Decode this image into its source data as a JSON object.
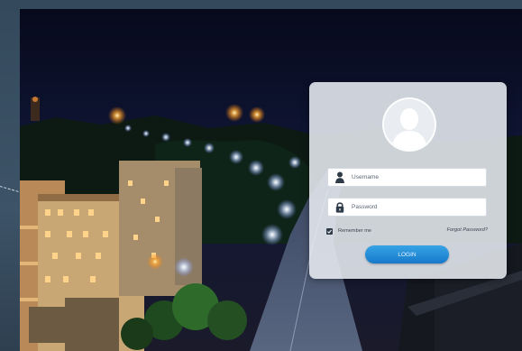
{
  "login": {
    "username_placeholder": "Username",
    "password_placeholder": "Password",
    "remember_label": "Remember me",
    "remember_checked": true,
    "forgot_label": "Forgot Password?",
    "login_label": "LOGIN"
  },
  "icons": {
    "avatar": "user-silhouette-icon",
    "username": "user-icon",
    "password": "lock-icon",
    "remember": "check-icon"
  },
  "colors": {
    "button": "#1e88d6",
    "card": "#e8ecf1",
    "field_icon": "#2f3b49"
  }
}
